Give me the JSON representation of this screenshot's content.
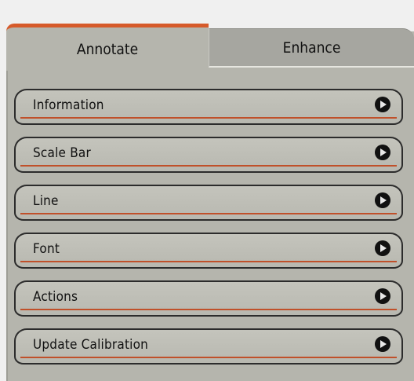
{
  "tabs": [
    {
      "label": "Annotate",
      "active": true
    },
    {
      "label": "Enhance",
      "active": false
    }
  ],
  "items": [
    {
      "label": "Information",
      "icon": "play-arrow-icon"
    },
    {
      "label": "Scale Bar",
      "icon": "play-arrow-icon"
    },
    {
      "label": "Line",
      "icon": "play-arrow-icon"
    },
    {
      "label": "Font",
      "icon": "play-arrow-icon"
    },
    {
      "label": "Actions",
      "icon": "play-arrow-icon"
    },
    {
      "label": "Update Calibration",
      "icon": "play-arrow-icon"
    }
  ],
  "colors": {
    "panel_bg": "#b5b5ad",
    "active_tab_accent": "#d65a2a",
    "underline": "#c0502a"
  }
}
